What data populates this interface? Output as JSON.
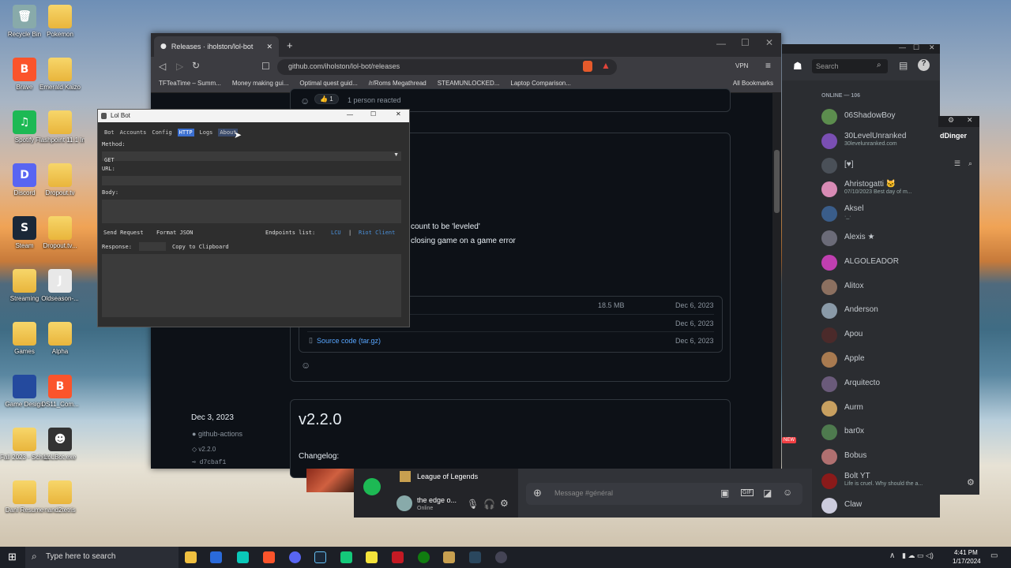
{
  "desktop": {
    "icons": [
      {
        "label": "Recycle Bin",
        "glyph": "🗑"
      },
      {
        "label": "Pokemon",
        "glyph": ""
      },
      {
        "label": "Brave",
        "glyph": "B"
      },
      {
        "label": "Emerald Kaizo",
        "glyph": ""
      },
      {
        "label": "Spotify",
        "glyph": "♫"
      },
      {
        "label": "Flashpoint 11.1 Infinity",
        "glyph": ""
      },
      {
        "label": "Discord",
        "glyph": "D"
      },
      {
        "label": "Dropout.tv",
        "glyph": ""
      },
      {
        "label": "Steam",
        "glyph": "S"
      },
      {
        "label": "Dropout.tv...",
        "glyph": ""
      },
      {
        "label": "Streaming",
        "glyph": ""
      },
      {
        "label": "Oldseason-...",
        "glyph": "J"
      },
      {
        "label": "Games",
        "glyph": ""
      },
      {
        "label": "Alpha",
        "glyph": ""
      },
      {
        "label": "Game Design",
        "glyph": ""
      },
      {
        "label": "DS11_Com...",
        "glyph": "B"
      },
      {
        "label": "Fall 2023 - School",
        "glyph": ""
      },
      {
        "label": "LoLBot.exe",
        "glyph": "☻"
      },
      {
        "label": "Dani Resume",
        "glyph": ""
      },
      {
        "label": "nand2tetris",
        "glyph": ""
      }
    ]
  },
  "browser": {
    "tab_title": "Releases · iholston/lol-bot",
    "new_tab": "+",
    "url": "github.com/iholston/lol-bot/releases",
    "vpn": "VPN",
    "bookmarks": [
      "TFTeaTime – Summ...",
      "Money making gui...",
      "Optimal quest guid...",
      "/r/Roms Megathread",
      "STEAMUNLOCKED...",
      "Laptop Comparison..."
    ],
    "all_bookmarks": "All Bookmarks",
    "reacted": "1 person reacted",
    "reaction_count": "1",
    "line1": "count to be 'leveled'",
    "line2": "closing game on a game error",
    "assets": [
      {
        "name": "",
        "size": "18.5 MB",
        "date": "Dec 6, 2023"
      },
      {
        "name": "",
        "size": "",
        "date": "Dec 6, 2023"
      },
      {
        "name": "Source code (tar.gz)",
        "size": "",
        "date": "Dec 6, 2023"
      }
    ],
    "release2": {
      "date": "Dec 3, 2023",
      "author": "github-actions",
      "tag": "v2.2.0",
      "commit": "d7cbaf1",
      "title": "v2.2.0",
      "changelog": "Changelog:"
    }
  },
  "lolbot": {
    "title": "Lol Bot",
    "menu": [
      "Bot",
      "Accounts",
      "Config",
      "HTTP",
      "Logs",
      "About"
    ],
    "method_label": "Method:",
    "method_value": "GET",
    "url_label": "URL:",
    "url_value": "",
    "body_label": "Body:",
    "send_request": "Send Request",
    "format_json": "Format JSON",
    "endpoints_label": "Endpoints list:",
    "lcu": "LCU",
    "sep": "|",
    "riot_client": "Riot Client",
    "response_label": "Response:",
    "copy_clipboard": "Copy to Clipboard"
  },
  "discord": {
    "search_placeholder": "Search",
    "online_header": "ONLINE — 106",
    "members": [
      {
        "name": "06ShadowBoy",
        "status": "",
        "color": "#5c8d4e"
      },
      {
        "name": "30LevelUnranked",
        "status": "30levelunranked.com",
        "color": "#7a4fb3"
      },
      {
        "name": "[♥]",
        "status": "",
        "color": "#4a5058"
      },
      {
        "name": "Ahristogatti 🐱",
        "status": "07/10/2023 Best day of m...",
        "color": "#d88bb5"
      },
      {
        "name": "Aksel",
        "status": "·_·",
        "color": "#3a5d8a"
      },
      {
        "name": "Alexis ★",
        "status": "",
        "color": "#6b6b78"
      },
      {
        "name": "ALGOLEADOR",
        "status": "",
        "color": "#c03fb0"
      },
      {
        "name": "Alitox",
        "status": "",
        "color": "#8c7060"
      },
      {
        "name": "Anderson",
        "status": "",
        "color": "#8a9aa8"
      },
      {
        "name": "Apou",
        "status": "",
        "color": "#4b2a2a"
      },
      {
        "name": "Apple",
        "status": "",
        "color": "#a87a50"
      },
      {
        "name": "Arquitecto",
        "status": "",
        "color": "#6a5a7a"
      },
      {
        "name": "Aurm",
        "status": "",
        "color": "#c8a060"
      },
      {
        "name": "bar0x",
        "status": "",
        "color": "#4e7a4e"
      },
      {
        "name": "Bobus",
        "status": "",
        "color": "#b07070"
      },
      {
        "name": "Bolt YT",
        "status": "Life is cruel. Why should the a...",
        "color": "#8a1a1a"
      },
      {
        "name": "Claw",
        "status": "",
        "color": "#ccd"
      }
    ],
    "side_label": "dDinger",
    "game": "League of Legends",
    "user_name": "the edge o...",
    "user_status": "Online",
    "message_placeholder": "Message #général",
    "new_badge": "NEW"
  },
  "taskbar": {
    "search_placeholder": "Type here to search",
    "time": "4:41 PM",
    "date": "1/17/2024"
  }
}
